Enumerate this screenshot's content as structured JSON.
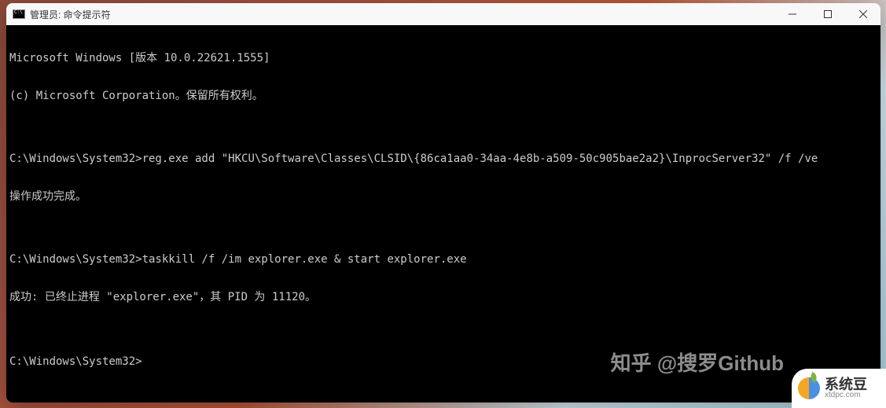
{
  "window": {
    "title": "管理员: 命令提示符"
  },
  "terminal": {
    "line1": "Microsoft Windows [版本 10.0.22621.1555]",
    "line2": "(c) Microsoft Corporation。保留所有权利。",
    "blank1": "",
    "prompt1": "C:\\Windows\\System32>",
    "cmd1": "reg.exe add \"HKCU\\Software\\Classes\\CLSID\\{86ca1aa0-34aa-4e8b-a509-50c905bae2a2}\\InprocServer32\" /f /ve",
    "result1": "操作成功完成。",
    "blank2": "",
    "prompt2": "C:\\Windows\\System32>",
    "cmd2": "taskkill /f /im explorer.exe & start explorer.exe",
    "result2": "成功: 已终止进程 \"explorer.exe\"，其 PID 为 11120。",
    "blank3": "",
    "prompt3": "C:\\Windows\\System32>"
  },
  "watermark": {
    "zhihu": "知乎 @搜罗Github",
    "logo_main": "系统豆",
    "logo_sub": "xtdpc.com"
  }
}
